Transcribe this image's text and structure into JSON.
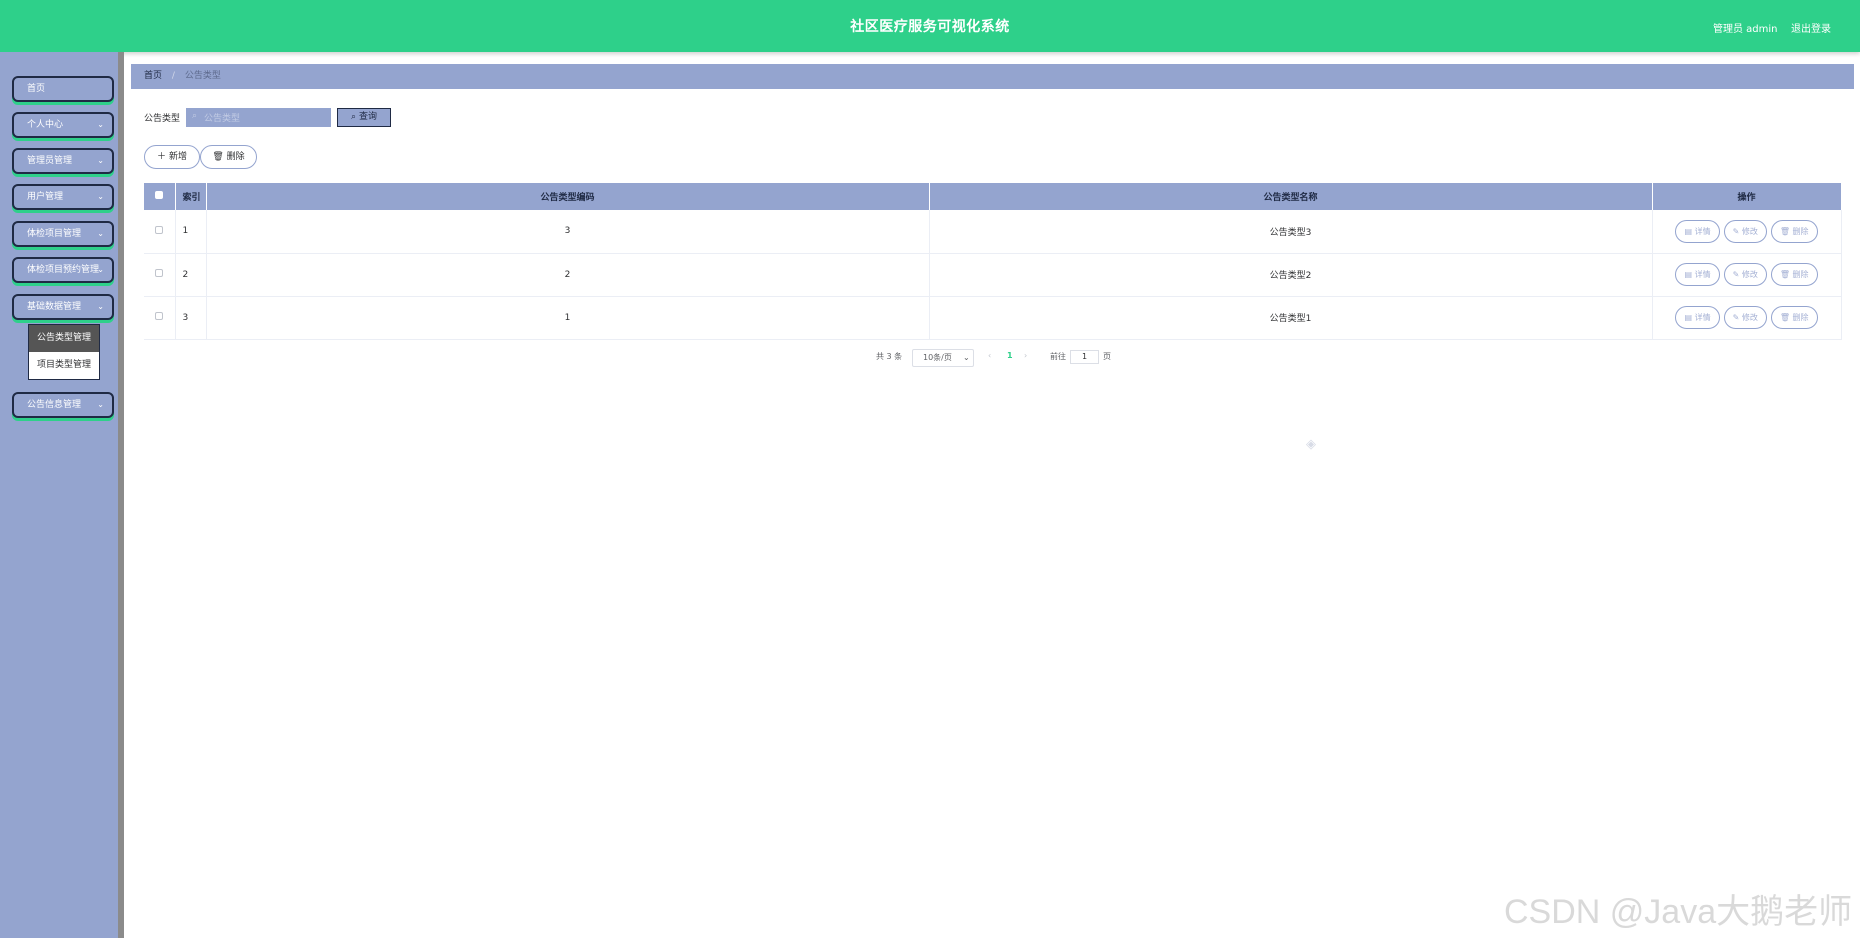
{
  "header": {
    "title": "社区医疗服务可视化系统",
    "user": "管理员 admin",
    "logout": "退出登录"
  },
  "sidebar": {
    "items": [
      {
        "label": "首页",
        "has_children": false
      },
      {
        "label": "个人中心",
        "has_children": true
      },
      {
        "label": "管理员管理",
        "has_children": true
      },
      {
        "label": "用户管理",
        "has_children": true
      },
      {
        "label": "体检项目管理",
        "has_children": true
      },
      {
        "label": "体检项目预约管理",
        "has_children": true
      },
      {
        "label": "基础数据管理",
        "has_children": true
      },
      {
        "label": "公告信息管理",
        "has_children": true
      }
    ],
    "submenu": [
      {
        "label": "公告类型管理",
        "active": true
      },
      {
        "label": "项目类型管理",
        "active": false
      }
    ]
  },
  "breadcrumb": {
    "home": "首页",
    "separator": "/",
    "current": "公告类型"
  },
  "search": {
    "label": "公告类型",
    "placeholder": "公告类型",
    "button": "查询"
  },
  "actions": {
    "add": "新增",
    "delete": "删除"
  },
  "table": {
    "columns": [
      "索引",
      "公告类型编码",
      "公告类型名称",
      "操作"
    ],
    "rows": [
      {
        "index": "1",
        "code": "3",
        "name": "公告类型3"
      },
      {
        "index": "2",
        "code": "2",
        "name": "公告类型2"
      },
      {
        "index": "3",
        "code": "1",
        "name": "公告类型1"
      }
    ],
    "row_actions": [
      "详情",
      "修改",
      "删除"
    ]
  },
  "pagination": {
    "total": "共 3 条",
    "page_size": "10条/页",
    "current_page": "1",
    "goto_label": "前往",
    "goto_value": "1",
    "page_suffix": "页"
  },
  "watermark": "CSDN @Java大鹅老师",
  "colors": {
    "header": "#2ed08a",
    "sidebar": "#94a4cf",
    "accent": "#1f2a44"
  }
}
